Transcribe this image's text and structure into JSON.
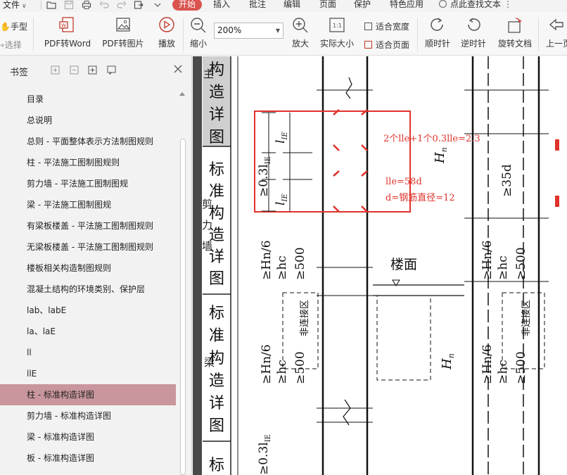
{
  "menubar": {
    "file_label": "文件",
    "items": [
      "插入",
      "批注",
      "编辑",
      "页面",
      "保护",
      "特色应用"
    ],
    "active_tab": "开始",
    "search_hint": "点此查找文本"
  },
  "ribbon": {
    "hand_tool": "手型",
    "select_tool": "选择",
    "pdf_to_word": "PDF转Word",
    "pdf_to_image": "PDF转图片",
    "play": "播放",
    "zoom_out": "缩小",
    "zoom_value": "200%",
    "zoom_in": "放大",
    "actual_size": "实际大小",
    "fit_width": "适合宽度",
    "fit_page": "适合页面",
    "rotate_cw": "顺时针",
    "rotate_ccw": "逆时针",
    "rotate_doc": "旋转文档",
    "prev_page": "上一页"
  },
  "bookmarks": {
    "title": "书签",
    "items": [
      "目录",
      "总说明",
      "总则 - 平面整体表示方法制图规则",
      "柱 - 平法施工图制图规则",
      "剪力墙 - 平法施工图制图规",
      "梁 - 平法施工图制图规",
      "有梁板楼盖 - 平法施工图制图规则",
      "无梁板楼盖 - 平法施工图制图规则",
      "楼板相关构造制图规则",
      "混凝土结构的环境类别、保护层",
      "lab、labE",
      "la、laE",
      "ll",
      "llE",
      "柱 - 标准构造详图",
      "剪力墙 - 标准构造详图",
      "梁 - 标准构造详图",
      "板 - 标准构造详图"
    ],
    "selected_index": 14
  },
  "document": {
    "side_title_1": [
      "构",
      "造",
      "详",
      "图"
    ],
    "side_title_2": [
      "标",
      "准",
      "构",
      "造",
      "详",
      "图"
    ],
    "side_title_3": [
      "标",
      "准",
      "构",
      "造",
      "详",
      "图"
    ],
    "side_title_4": [
      "标"
    ],
    "lap_label_1": "≥0.3l",
    "lap_sub_1": "IE",
    "lap_label_2": "l",
    "lap_sub_2": "IE",
    "hn_label": "H",
    "hn_sub": "n",
    "d35_label": "≥35d",
    "floor_label": "楼面",
    "nonconn_label": "非连接区",
    "hn6_label": "≥Hn/6",
    "hc_label": "≥hc",
    "mm500_label": "≥500",
    "annotation_1": "2个lle+1个0.3lle=2.3",
    "annotation_2": "lle=58d",
    "annotation_3": "d=钢筋直径=12"
  },
  "colors": {
    "accent_red": "#d9534f",
    "selected_bookmark": "#c8969c",
    "annotation_red": "#e0332b"
  }
}
